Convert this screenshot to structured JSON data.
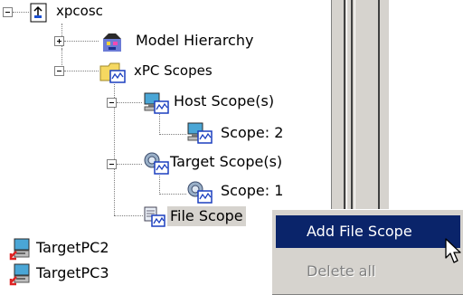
{
  "tree": {
    "root": {
      "label": "xpcosc",
      "icon": "model-file-icon"
    },
    "model_hierarchy": {
      "label": "Model Hierarchy",
      "icon": "model-hierarchy-icon"
    },
    "xpc_scopes": {
      "label": "xPC Scopes",
      "icon": "scopes-folder-icon"
    },
    "host_scopes": {
      "label": "Host Scope(s)",
      "icon": "host-scope-icon"
    },
    "host_scope_2": {
      "label": "Scope: 2",
      "icon": "host-scope-icon"
    },
    "target_scopes": {
      "label": "Target Scope(s)",
      "icon": "target-scope-icon"
    },
    "target_scope_1": {
      "label": "Scope: 1",
      "icon": "target-scope-icon"
    },
    "file_scopes": {
      "label": "File Scope",
      "icon": "file-scope-icon"
    },
    "targets": [
      {
        "label": "TargetPC2",
        "icon": "target-pc-icon"
      },
      {
        "label": "TargetPC3",
        "icon": "target-pc-icon"
      }
    ]
  },
  "context_menu": {
    "items": [
      {
        "label": "Add File Scope",
        "state": "highlighted"
      },
      {
        "label": "Delete all",
        "state": "disabled"
      }
    ]
  },
  "colors": {
    "selection": "#0a246a",
    "menu_face": "#d6d3ce",
    "disabled_text": "#808080"
  }
}
